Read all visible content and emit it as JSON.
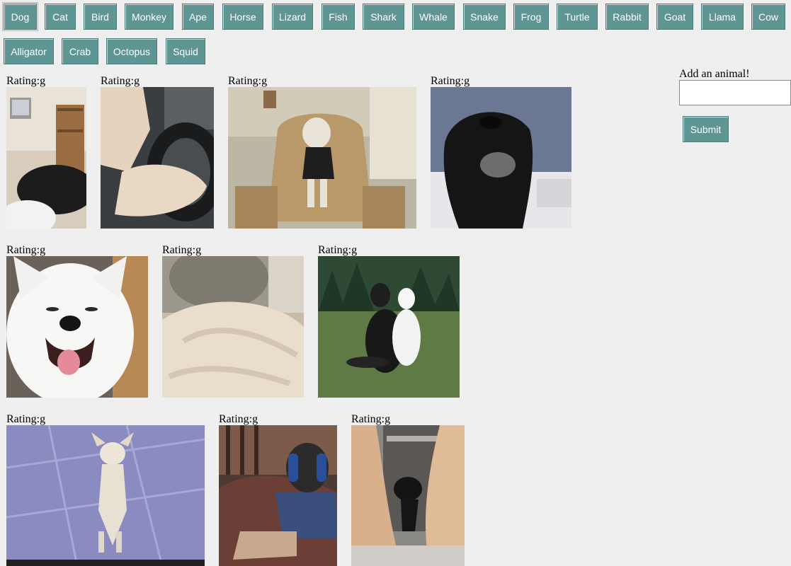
{
  "nav": {
    "buttons": [
      "Dog",
      "Cat",
      "Bird",
      "Monkey",
      "Ape",
      "Horse",
      "Lizard",
      "Fish",
      "Shark",
      "Whale",
      "Snake",
      "Frog",
      "Turtle",
      "Rabbit",
      "Goat",
      "Llama",
      "Cow",
      "Alligator",
      "Crab",
      "Octopus",
      "Squid"
    ],
    "selected": "Dog"
  },
  "gifs": [
    {
      "rating": "Rating:g",
      "alt": "black puppy on rug in room with tv"
    },
    {
      "rating": "Rating:g",
      "alt": "fluffy dog paw on steering wheel"
    },
    {
      "rating": "Rating:g",
      "alt": "dog in shirt sitting on armchair"
    },
    {
      "rating": "Rating:g",
      "alt": "black dog lying down close-up"
    },
    {
      "rating": "Rating:g",
      "alt": "smiling white samoyed"
    },
    {
      "rating": "Rating:g",
      "alt": "fluffy white dog on rug"
    },
    {
      "rating": "Rating:g",
      "alt": "two border collies sitting on grass"
    },
    {
      "rating": "Rating:g",
      "alt": "chihuahua standing on hind legs"
    },
    {
      "rating": "Rating:g",
      "alt": "pug wearing headphones on couch"
    },
    {
      "rating": "Rating:g",
      "alt": "small black dog between people"
    }
  ],
  "form": {
    "label": "Add an animal!",
    "input_value": "",
    "submit_label": "Submit"
  },
  "colors": {
    "button_bg": "#5f9693",
    "page_bg": "#efefef"
  }
}
